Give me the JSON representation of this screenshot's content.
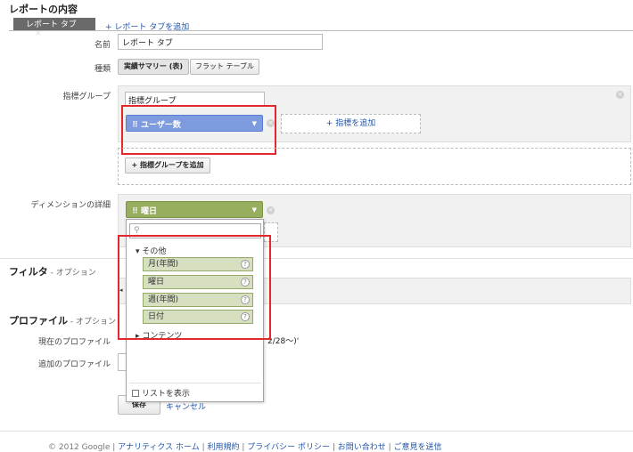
{
  "section": {
    "title": "レポートの内容"
  },
  "tab": {
    "active_label": "レポート タブ",
    "close": "×",
    "add_label": "+ レポート タブを追加"
  },
  "form": {
    "name_label": "名前",
    "name_value": "レポート タブ",
    "type_label": "種類",
    "type_options": [
      "実績サマリー (表)",
      "フラット テーブル"
    ],
    "metric_group_label": "指標グループ",
    "metric_group_name": "指標グループ",
    "metric_chip": "ユーザー数",
    "add_metric": "+ 指標を追加",
    "add_metric_group": "+ 指標グループを追加",
    "dimension_label": "ディメンションの詳細",
    "dimension_chip": "曜日"
  },
  "dropdown": {
    "search_placeholder": "",
    "group_other": "▾ その他",
    "items": [
      "月(年間)",
      "曜日",
      "週(年間)",
      "日付"
    ],
    "group_content": "▸ コンテンツ",
    "show_list": "リストを表示"
  },
  "filter": {
    "title": "フィルタ",
    "optional": " - オプション"
  },
  "profile": {
    "title": "プロファイル",
    "optional": " - オプション",
    "current_label": "現在のプロファイル",
    "current_value_tail": "2/28〜)'",
    "additional_label": "追加のプロファイル"
  },
  "actions": {
    "save": "保存",
    "cancel": "キャンセル"
  },
  "footer": {
    "copyright": "© 2012 Google",
    "links": [
      "アナリティクス ホーム",
      "利用規約",
      "プライバシー ポリシー",
      "お問い合わせ",
      "ご意見を送信"
    ]
  }
}
